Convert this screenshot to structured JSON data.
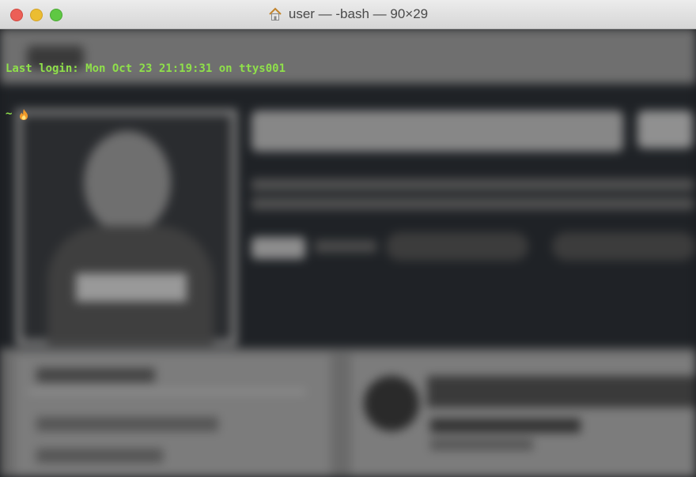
{
  "window": {
    "title": "user — -bash — 90×29",
    "title_icon": "home-icon"
  },
  "terminal": {
    "last_login": "Last login: Mon Oct 23 21:19:31 on ttys001",
    "prompt": "~",
    "prompt_icon": "flame-icon",
    "text_color": "#8fe04a"
  },
  "colors": {
    "close": "#ec5f57",
    "minimize": "#ebbd32",
    "zoom": "#5fc843"
  }
}
